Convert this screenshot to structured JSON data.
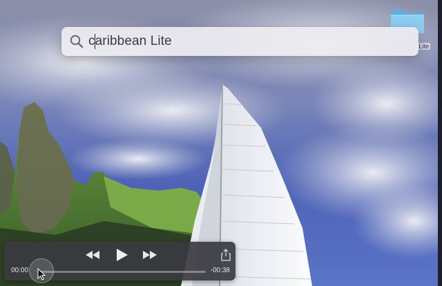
{
  "spotlight": {
    "query": "caribbean Lite"
  },
  "desktop": {
    "folder_label": "Lite"
  },
  "player": {
    "elapsed": "00:00",
    "remaining": "-00:38",
    "progress": 0.0
  },
  "icons": {
    "search": "search-icon",
    "folder": "folder-icon",
    "rewind": "rewind-icon",
    "play": "play-icon",
    "fast_forward": "fast-forward-icon",
    "share": "share-icon",
    "pointer": "mouse-pointer-icon"
  },
  "colors": {
    "sky": "#6a7dbf",
    "sail": "#f2f4f8",
    "hills": "#5a8a3a",
    "folder": "#7cc0ea"
  }
}
